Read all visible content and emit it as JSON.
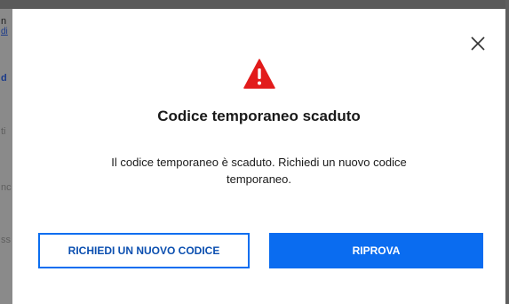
{
  "background_page": {
    "fragments": [
      {
        "text": "n",
        "style": "normal"
      },
      {
        "text": "di",
        "style": "link"
      },
      {
        "text": "d",
        "style": "bold"
      },
      {
        "text": "ti",
        "style": "faint"
      },
      {
        "text": "nc",
        "style": "faint"
      },
      {
        "text": "ss",
        "style": "faint"
      }
    ]
  },
  "dialog": {
    "close_icon": "close-icon",
    "warning_icon": "warning-triangle-icon",
    "warning_color": "#e21b1b",
    "title": "Codice temporaneo scaduto",
    "message": "Il codice temporaneo è scaduto. Richiedi un nuovo codice temporaneo.",
    "secondary_button": "RICHIEDI UN NUOVO CODICE",
    "primary_button": "RIPROVA",
    "accent_color": "#0a6cf0"
  }
}
